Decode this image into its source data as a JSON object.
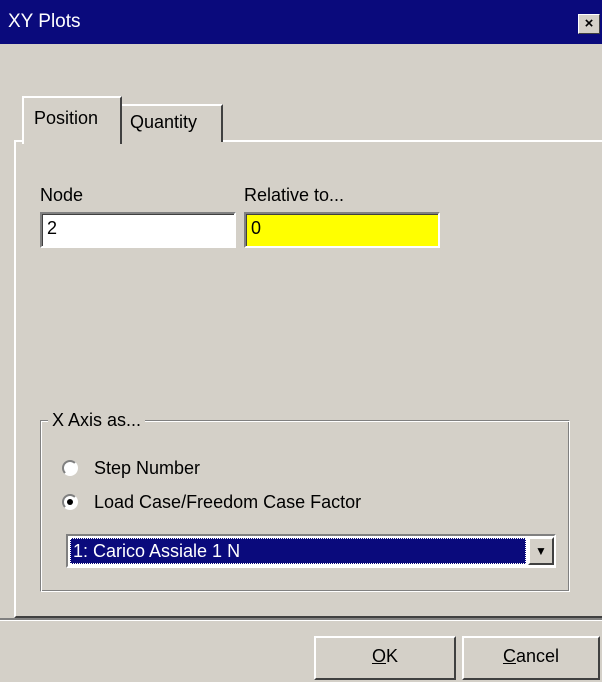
{
  "window": {
    "title": "XY Plots",
    "close_glyph": "×"
  },
  "tabs": [
    {
      "label": "Position",
      "selected": true
    },
    {
      "label": "Quantity",
      "selected": false
    }
  ],
  "position_tab": {
    "node_label": "Node",
    "node_value": "2",
    "relative_label": "Relative to...",
    "relative_value": "0",
    "relative_bg": "#ffff00"
  },
  "x_axis_group": {
    "legend": "X Axis as...",
    "options": [
      {
        "label": "Step Number",
        "selected": false
      },
      {
        "label": "Load Case/Freedom Case Factor",
        "selected": true
      }
    ],
    "dropdown_value": "1: Carico Assiale 1 N",
    "dropdown_arrow": "▼"
  },
  "buttons": {
    "ok": {
      "mnemonic": "O",
      "rest": "K"
    },
    "cancel": {
      "mnemonic": "C",
      "rest": "ancel"
    }
  },
  "colors": {
    "titlebar": "#0a0a7c",
    "face": "#d4d0c8",
    "highlight": "#0a0a7c",
    "relative_field": "#ffff00"
  }
}
